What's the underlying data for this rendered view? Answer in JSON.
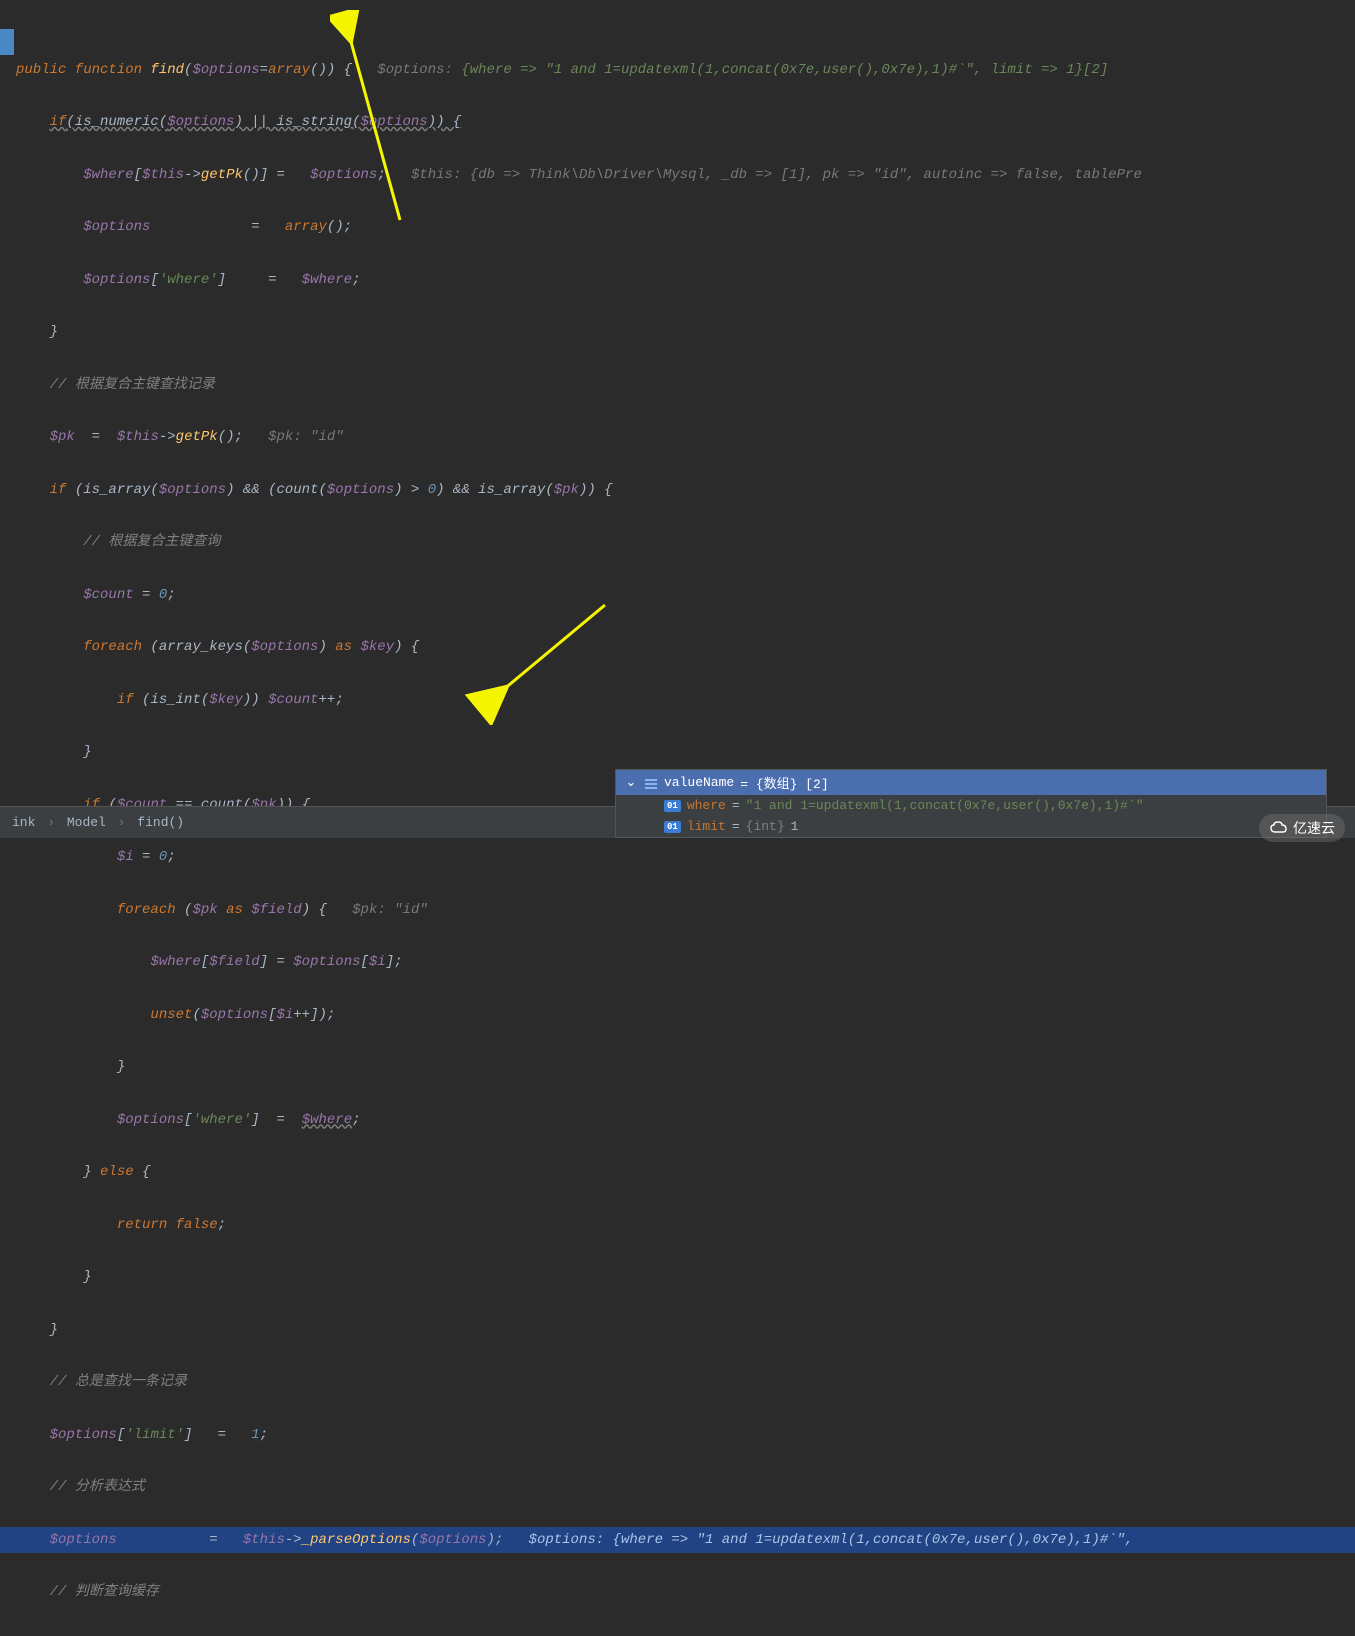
{
  "code": {
    "l1_pre": "public function ",
    "l1_fn": "find",
    "l1_post1": "(",
    "l1_var": "$options",
    "l1_eq": "=",
    "l1_arr": "array",
    "l1_post2": "()) {   ",
    "l1_hint": "$options: ",
    "l1_hintval": "{where => \"1 and 1=updatexml(1,concat(0x7e,user(),0x7e),1)#`\", limit => 1}[2]",
    "l2_if": "if",
    "l2_body": "(is_numeric(",
    "l2_opt": "$options",
    "l2_mid": ") || is_string(",
    "l2_opt2": "$options",
    "l2_end": ")) {",
    "l3_where": "$where",
    "l3_br1": "[",
    "l3_this": "$this",
    "l3_arrow": "->",
    "l3_getpk": "getPk",
    "l3_br2": "()] =   ",
    "l3_opt": "$options",
    "l3_semi": ";   ",
    "l3_hint": "$this: {db => Think\\Db\\Driver\\Mysql, _db => [1], pk => \"id\", autoinc => false, tablePre",
    "l4_opt": "$options",
    "l4_sp": "            =   ",
    "l4_arr": "array",
    "l4_end": "();",
    "l5_opt": "$options",
    "l5_br": "[",
    "l5_str": "'where'",
    "l5_mid": "]     =   ",
    "l5_where": "$where",
    "l5_semi": ";",
    "l6": "}",
    "l7": "// 根据复合主键查找记录",
    "l8_pk": "$pk",
    "l8_sp": "  =  ",
    "l8_this": "$this",
    "l8_arrow": "->",
    "l8_getpk": "getPk",
    "l8_end": "();   ",
    "l8_hint": "$pk: \"id\"",
    "l9_if": "if",
    "l9_p1": " (is_array(",
    "l9_opt": "$options",
    "l9_p2": ") && (count(",
    "l9_opt2": "$options",
    "l9_p3": ") > ",
    "l9_zero": "0",
    "l9_p4": ") && is_array(",
    "l9_pk": "$pk",
    "l9_p5": ")) {",
    "l10": "// 根据复合主键查询",
    "l11_count": "$count",
    "l11_eq": " = ",
    "l11_zero": "0",
    "l11_semi": ";",
    "l12_fe": "foreach",
    "l12_p1": " (array_keys(",
    "l12_opt": "$options",
    "l12_p2": ") ",
    "l12_as": "as",
    "l12_sp": " ",
    "l12_key": "$key",
    "l12_p3": ") {",
    "l13_if": "if",
    "l13_p1": " (is_int(",
    "l13_key": "$key",
    "l13_p2": ")) ",
    "l13_count": "$count",
    "l13_inc": "++;",
    "l14": "}",
    "l15_if": "if",
    "l15_p1": " (",
    "l15_count": "$count",
    "l15_p2": " == count(",
    "l15_pk": "$pk",
    "l15_p3": ")) {",
    "l16_i": "$i",
    "l16_eq": " = ",
    "l16_zero": "0",
    "l16_semi": ";",
    "l17_fe": "foreach",
    "l17_p1": " (",
    "l17_pk": "$pk",
    "l17_sp": " ",
    "l17_as": "as",
    "l17_sp2": " ",
    "l17_field": "$field",
    "l17_p2": ") {   ",
    "l17_hint": "$pk: \"id\"",
    "l18_where": "$where",
    "l18_b1": "[",
    "l18_field": "$field",
    "l18_b2": "] = ",
    "l18_opt": "$options",
    "l18_b3": "[",
    "l18_i": "$i",
    "l18_b4": "];",
    "l19_unset": "unset",
    "l19_p1": "(",
    "l19_opt": "$options",
    "l19_b1": "[",
    "l19_i": "$i",
    "l19_inc": "++]);",
    "l20": "}",
    "l21_opt": "$options",
    "l21_b1": "[",
    "l21_str": "'where'",
    "l21_b2": "]  =  ",
    "l21_where": "$where",
    "l21_semi": ";",
    "l22_cb": "} ",
    "l22_else": "else",
    "l22_ob": " {",
    "l23_ret": "return false",
    "l23_semi": ";",
    "l24": "}",
    "l25": "}",
    "l26": "// 总是查找一条记录",
    "l27_opt": "$options",
    "l27_b1": "[",
    "l27_str": "'limit'",
    "l27_b2": "]   =   ",
    "l27_one": "1",
    "l27_semi": ";",
    "l28": "// 分析表达式",
    "l29_opt": "$options",
    "l29_sp": "           =   ",
    "l29_this": "$this",
    "l29_arrow": "->",
    "l29_parse": "_parseOptions",
    "l29_p1": "(",
    "l29_opt2": "$options",
    "l29_p2": ");   ",
    "l29_hint": "$options: {where => \"1 and 1=updatexml(1,concat(0x7e,user(),0x7e),1)#`\",",
    "l30": "// 判断查询缓存"
  },
  "breadcrumb": {
    "b1": "ink",
    "b2": "Model",
    "b3": "find()"
  },
  "debug": {
    "header_name": "valueName",
    "header_val": " = {数组} [2]",
    "row1_key": "where",
    "row1_eq": " = ",
    "row1_val": "\"1 and 1=updatexml(1,concat(0x7e,user(),0x7e),1)#`\"",
    "row2_key": "limit",
    "row2_eq": " = ",
    "row2_type": "{int} ",
    "row2_val": "1",
    "badge": "01"
  },
  "watermark": "亿速云"
}
